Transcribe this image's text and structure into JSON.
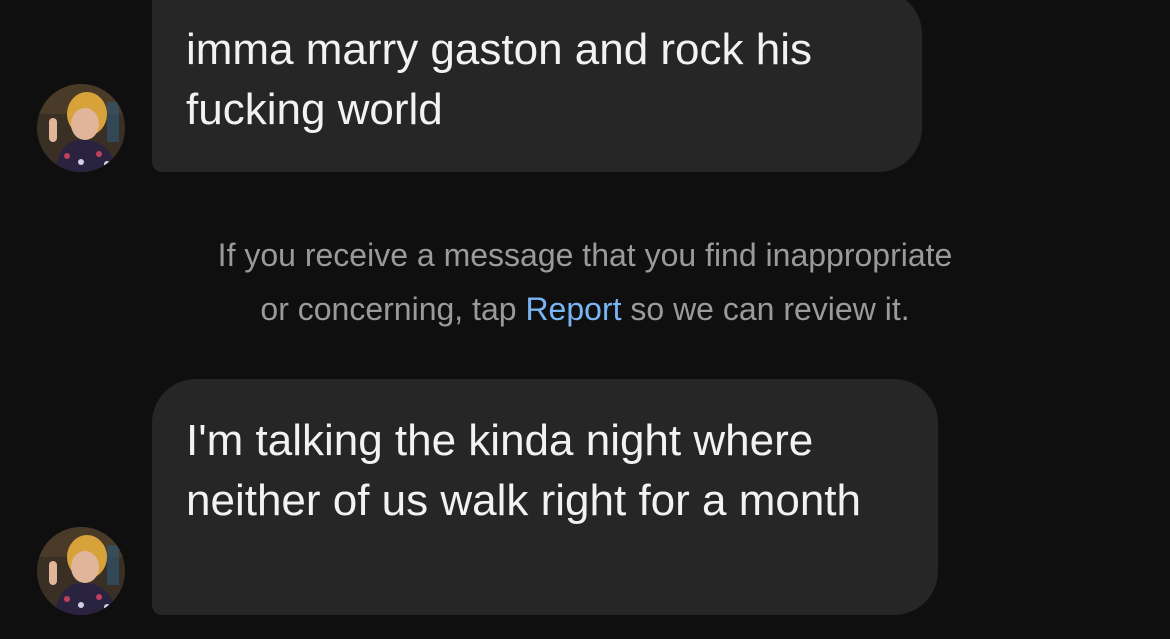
{
  "messages": [
    {
      "text": "imma marry gaston and rock his fucking world"
    },
    {
      "text": "I'm talking the kinda night where neither of us walk right for a month"
    }
  ],
  "notice": {
    "line1": "If you receive a message that you find inappropriate",
    "line2_before": "or concerning, tap ",
    "report_link": "Report",
    "line2_after": " so we can review it."
  },
  "colors": {
    "background": "#0f0f0f",
    "bubble": "#262626",
    "link": "#7ab4f2"
  }
}
